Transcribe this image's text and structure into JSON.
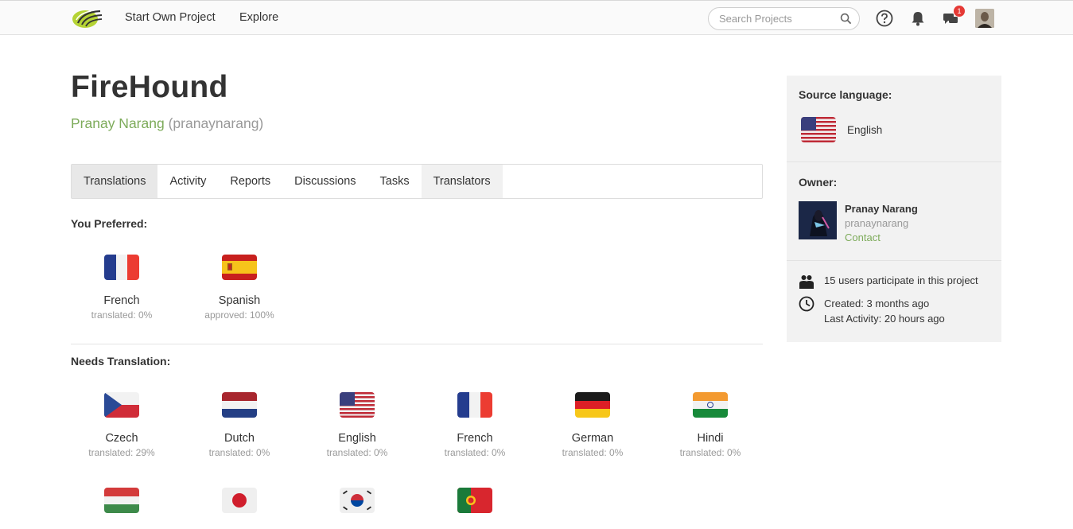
{
  "nav": {
    "start_label": "Start Own Project",
    "explore_label": "Explore",
    "search_placeholder": "Search Projects",
    "notif_count": "1"
  },
  "project": {
    "title": "FireHound",
    "owner_name": "Pranay Narang",
    "owner_handle": "(pranaynarang)"
  },
  "tabs": [
    {
      "label": "Translations",
      "active": true
    },
    {
      "label": "Activity"
    },
    {
      "label": "Reports"
    },
    {
      "label": "Discussions"
    },
    {
      "label": "Tasks"
    },
    {
      "label": "Translators"
    }
  ],
  "preferred": {
    "heading": "You Preferred:",
    "items": [
      {
        "name": "French",
        "status": "translated: 0%",
        "flag": "flag-france"
      },
      {
        "name": "Spanish",
        "status": "approved: 100%",
        "flag": "flag-spain"
      }
    ]
  },
  "needs": {
    "heading": "Needs Translation:",
    "items": [
      {
        "name": "Czech",
        "status": "translated: 29%",
        "flag": "flag-czech"
      },
      {
        "name": "Dutch",
        "status": "translated: 0%",
        "flag": "flag-netherlands"
      },
      {
        "name": "English",
        "status": "translated: 0%",
        "flag": "flag-usa"
      },
      {
        "name": "French",
        "status": "translated: 0%",
        "flag": "flag-france"
      },
      {
        "name": "German",
        "status": "translated: 0%",
        "flag": "flag-germany"
      },
      {
        "name": "Hindi",
        "status": "translated: 0%",
        "flag": "flag-india"
      },
      {
        "name": "",
        "status": "",
        "flag": "flag-hungary"
      },
      {
        "name": "",
        "status": "",
        "flag": "flag-japan"
      },
      {
        "name": "",
        "status": "",
        "flag": "flag-korea"
      },
      {
        "name": "",
        "status": "",
        "flag": "flag-portugal"
      }
    ]
  },
  "sidebar": {
    "source_heading": "Source language:",
    "source_language": "English",
    "owner_heading": "Owner:",
    "owner_name": "Pranay Narang",
    "owner_handle": "pranaynarang",
    "contact_label": "Contact",
    "participants": "15 users participate in this project",
    "created": "Created: 3 months ago",
    "last_activity": "Last Activity: 20 hours ago"
  },
  "colors": {
    "accent_green": "#7dab5a",
    "badge_red": "#e53935"
  }
}
